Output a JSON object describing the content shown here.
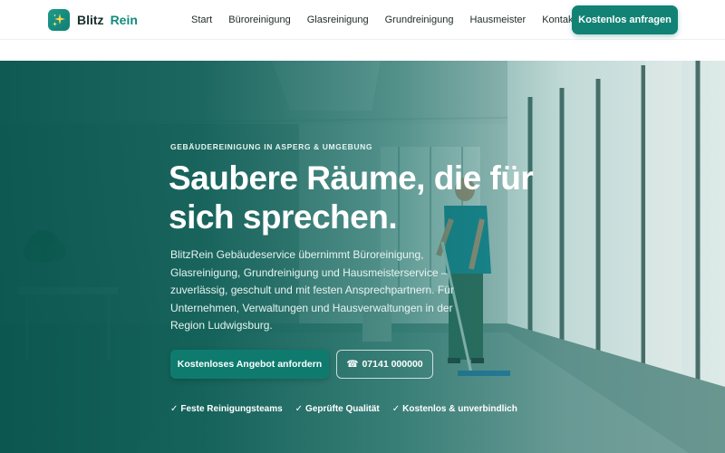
{
  "brand": {
    "name_part1": "Blitz",
    "name_part2": "Rein",
    "logo_icon": "sparkle-icon",
    "accent_color": "#128275"
  },
  "nav": {
    "items": [
      {
        "label": "Start"
      },
      {
        "label": "Büroreinigung"
      },
      {
        "label": "Glasreinigung"
      },
      {
        "label": "Grundreinigung"
      },
      {
        "label": "Hausmeister"
      },
      {
        "label": "Kontakt"
      }
    ],
    "cta_label": "Kostenlos anfragen"
  },
  "hero": {
    "eyebrow": "GEBÄUDEREINIGUNG IN ASPERG & UMGEBUNG",
    "headline_line1": "Saubere Räume, die für",
    "headline_line2": "sich sprechen.",
    "lead": "BlitzRein Gebäudeservice übernimmt Büroreinigung, Glasreinigung, Grundreinigung und Hausmeisterservice – zuverlässig, geschult und mit festen Ansprechpartnern. Für Unternehmen, Verwaltungen und Hausverwaltungen in der Region Ludwigsburg.",
    "primary_button": "Kostenloses Angebot anfordern",
    "phone_icon": "phone-icon",
    "phone_button": "07141 000000",
    "checks": [
      {
        "icon": "check-icon",
        "label": "Feste Reinigungsteams"
      },
      {
        "icon": "check-icon",
        "label": "Geprüfte Qualität"
      },
      {
        "icon": "check-icon",
        "label": "Kostenlos & unverbindlich"
      }
    ]
  }
}
